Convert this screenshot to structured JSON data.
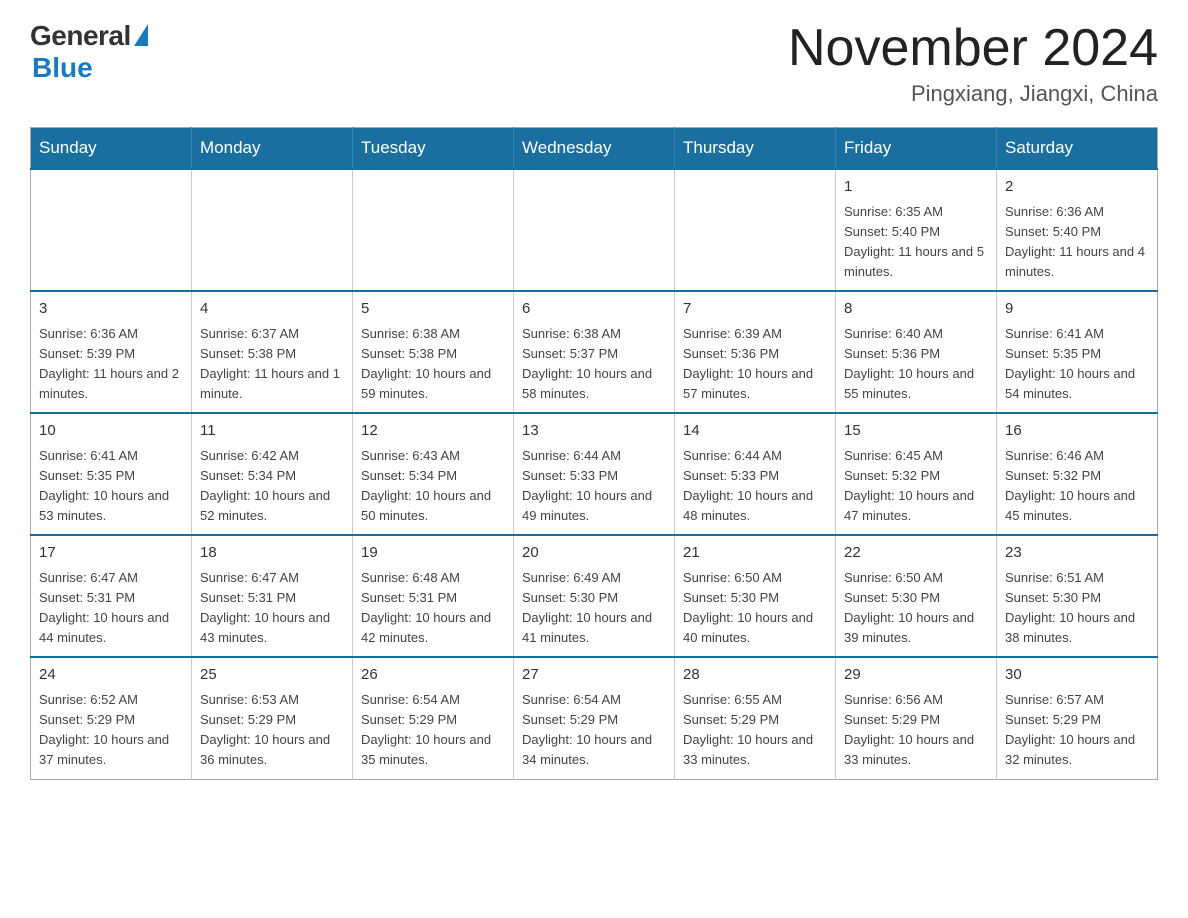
{
  "header": {
    "logo_general": "General",
    "logo_blue": "Blue",
    "month_year": "November 2024",
    "location": "Pingxiang, Jiangxi, China"
  },
  "weekdays": [
    "Sunday",
    "Monday",
    "Tuesday",
    "Wednesday",
    "Thursday",
    "Friday",
    "Saturday"
  ],
  "weeks": [
    [
      {
        "day": "",
        "info": ""
      },
      {
        "day": "",
        "info": ""
      },
      {
        "day": "",
        "info": ""
      },
      {
        "day": "",
        "info": ""
      },
      {
        "day": "",
        "info": ""
      },
      {
        "day": "1",
        "info": "Sunrise: 6:35 AM\nSunset: 5:40 PM\nDaylight: 11 hours and 5 minutes."
      },
      {
        "day": "2",
        "info": "Sunrise: 6:36 AM\nSunset: 5:40 PM\nDaylight: 11 hours and 4 minutes."
      }
    ],
    [
      {
        "day": "3",
        "info": "Sunrise: 6:36 AM\nSunset: 5:39 PM\nDaylight: 11 hours and 2 minutes."
      },
      {
        "day": "4",
        "info": "Sunrise: 6:37 AM\nSunset: 5:38 PM\nDaylight: 11 hours and 1 minute."
      },
      {
        "day": "5",
        "info": "Sunrise: 6:38 AM\nSunset: 5:38 PM\nDaylight: 10 hours and 59 minutes."
      },
      {
        "day": "6",
        "info": "Sunrise: 6:38 AM\nSunset: 5:37 PM\nDaylight: 10 hours and 58 minutes."
      },
      {
        "day": "7",
        "info": "Sunrise: 6:39 AM\nSunset: 5:36 PM\nDaylight: 10 hours and 57 minutes."
      },
      {
        "day": "8",
        "info": "Sunrise: 6:40 AM\nSunset: 5:36 PM\nDaylight: 10 hours and 55 minutes."
      },
      {
        "day": "9",
        "info": "Sunrise: 6:41 AM\nSunset: 5:35 PM\nDaylight: 10 hours and 54 minutes."
      }
    ],
    [
      {
        "day": "10",
        "info": "Sunrise: 6:41 AM\nSunset: 5:35 PM\nDaylight: 10 hours and 53 minutes."
      },
      {
        "day": "11",
        "info": "Sunrise: 6:42 AM\nSunset: 5:34 PM\nDaylight: 10 hours and 52 minutes."
      },
      {
        "day": "12",
        "info": "Sunrise: 6:43 AM\nSunset: 5:34 PM\nDaylight: 10 hours and 50 minutes."
      },
      {
        "day": "13",
        "info": "Sunrise: 6:44 AM\nSunset: 5:33 PM\nDaylight: 10 hours and 49 minutes."
      },
      {
        "day": "14",
        "info": "Sunrise: 6:44 AM\nSunset: 5:33 PM\nDaylight: 10 hours and 48 minutes."
      },
      {
        "day": "15",
        "info": "Sunrise: 6:45 AM\nSunset: 5:32 PM\nDaylight: 10 hours and 47 minutes."
      },
      {
        "day": "16",
        "info": "Sunrise: 6:46 AM\nSunset: 5:32 PM\nDaylight: 10 hours and 45 minutes."
      }
    ],
    [
      {
        "day": "17",
        "info": "Sunrise: 6:47 AM\nSunset: 5:31 PM\nDaylight: 10 hours and 44 minutes."
      },
      {
        "day": "18",
        "info": "Sunrise: 6:47 AM\nSunset: 5:31 PM\nDaylight: 10 hours and 43 minutes."
      },
      {
        "day": "19",
        "info": "Sunrise: 6:48 AM\nSunset: 5:31 PM\nDaylight: 10 hours and 42 minutes."
      },
      {
        "day": "20",
        "info": "Sunrise: 6:49 AM\nSunset: 5:30 PM\nDaylight: 10 hours and 41 minutes."
      },
      {
        "day": "21",
        "info": "Sunrise: 6:50 AM\nSunset: 5:30 PM\nDaylight: 10 hours and 40 minutes."
      },
      {
        "day": "22",
        "info": "Sunrise: 6:50 AM\nSunset: 5:30 PM\nDaylight: 10 hours and 39 minutes."
      },
      {
        "day": "23",
        "info": "Sunrise: 6:51 AM\nSunset: 5:30 PM\nDaylight: 10 hours and 38 minutes."
      }
    ],
    [
      {
        "day": "24",
        "info": "Sunrise: 6:52 AM\nSunset: 5:29 PM\nDaylight: 10 hours and 37 minutes."
      },
      {
        "day": "25",
        "info": "Sunrise: 6:53 AM\nSunset: 5:29 PM\nDaylight: 10 hours and 36 minutes."
      },
      {
        "day": "26",
        "info": "Sunrise: 6:54 AM\nSunset: 5:29 PM\nDaylight: 10 hours and 35 minutes."
      },
      {
        "day": "27",
        "info": "Sunrise: 6:54 AM\nSunset: 5:29 PM\nDaylight: 10 hours and 34 minutes."
      },
      {
        "day": "28",
        "info": "Sunrise: 6:55 AM\nSunset: 5:29 PM\nDaylight: 10 hours and 33 minutes."
      },
      {
        "day": "29",
        "info": "Sunrise: 6:56 AM\nSunset: 5:29 PM\nDaylight: 10 hours and 33 minutes."
      },
      {
        "day": "30",
        "info": "Sunrise: 6:57 AM\nSunset: 5:29 PM\nDaylight: 10 hours and 32 minutes."
      }
    ]
  ]
}
